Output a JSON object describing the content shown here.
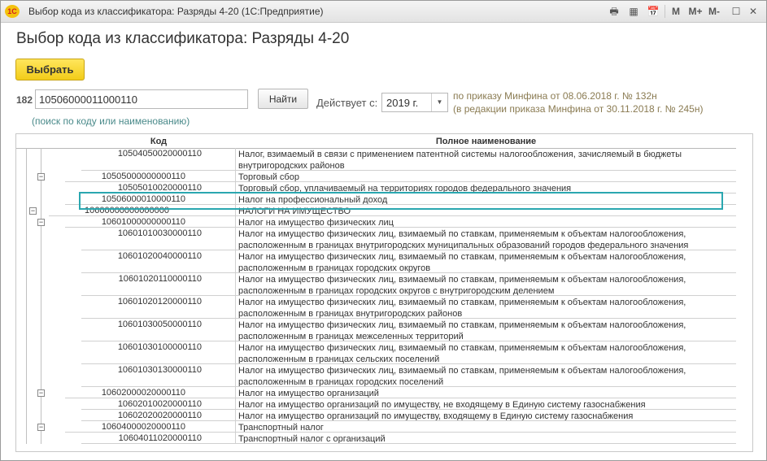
{
  "window": {
    "title": "Выбор кода из классификатора: Разряды 4-20",
    "app": "(1С:Предприятие)",
    "logo_text": "1С",
    "toolbar": [
      "M",
      "M+",
      "M-"
    ]
  },
  "form": {
    "heading": "Выбор кода из классификатора: Разряды 4-20",
    "select_button": "Выбрать",
    "code_prefix": "182",
    "code_value": "10506000011000110",
    "hint": "(поиск по коду или наименованию)",
    "find_button": "Найти",
    "valid_from_label": "Действует с:",
    "year_value": "2019 г.",
    "order_line1": "по приказу Минфина от 08.06.2018 г. № 132н",
    "order_line2": "(в редакции приказа Минфина от 30.11.2018 г. № 245н)",
    "accent_color": "#f2cc19",
    "highlight_color": "#2aa7b0"
  },
  "table": {
    "columns": [
      "Код",
      "Полное наименование"
    ],
    "rows": [
      {
        "code": "10504050020000110",
        "name": "Налог, взимаемый в связи с применением патентной системы налогообложения, зачисляемый в бюджеты внутригородских районов",
        "level": 4,
        "group": false
      },
      {
        "code": "10505000000000110",
        "name": "Торговый сбор",
        "level": 3,
        "group": true
      },
      {
        "code": "10505010020000110",
        "name": "Торговый сбор, уплачиваемый на территориях городов федерального значения",
        "level": 4,
        "group": false
      },
      {
        "code": "10506000010000110",
        "name": "Налог на профессиональный доход",
        "level": 3,
        "group": false
      },
      {
        "code": "10600000000000000",
        "name": "НАЛОГИ НА ИМУЩЕСТВО",
        "level": 2,
        "group": true
      },
      {
        "code": "10601000000000110",
        "name": "Налог на имущество физических лиц",
        "level": 3,
        "group": true
      },
      {
        "code": "10601010030000110",
        "name": "Налог на имущество физических лиц, взимаемый по ставкам, применяемым к объектам налогообложения, расположенным в границах внутригородских муниципальных образований городов федерального значения",
        "level": 4,
        "group": false
      },
      {
        "code": "10601020040000110",
        "name": "Налог на имущество физических лиц, взимаемый по ставкам, применяемым к объектам налогообложения, расположенным в границах городских округов",
        "level": 4,
        "group": false
      },
      {
        "code": "10601020110000110",
        "name": "Налог на имущество физических лиц, взимаемый по ставкам, применяемым к объектам налогообложения, расположенным в границах городских округов с внутригородским делением",
        "level": 4,
        "group": false
      },
      {
        "code": "10601020120000110",
        "name": "Налог на имущество физических лиц, взимаемый по ставкам, применяемым к объектам налогообложения, расположенным в границах внутригородских районов",
        "level": 4,
        "group": false
      },
      {
        "code": "10601030050000110",
        "name": "Налог на имущество физических лиц, взимаемый по ставкам, применяемым к объектам налогообложения, расположенным в границах межселенных территорий",
        "level": 4,
        "group": false
      },
      {
        "code": "10601030100000110",
        "name": "Налог на имущество физических лиц, взимаемый по ставкам, применяемым к объектам налогообложения, расположенным в границах сельских поселений",
        "level": 4,
        "group": false
      },
      {
        "code": "10601030130000110",
        "name": "Налог на имущество физических лиц, взимаемый по ставкам, применяемым к объектам налогообложения, расположенным в границах городских поселений",
        "level": 4,
        "group": false
      },
      {
        "code": "10602000020000110",
        "name": "Налог на имущество организаций",
        "level": 3,
        "group": true
      },
      {
        "code": "10602010020000110",
        "name": "Налог на имущество организаций по имуществу, не входящему в Единую систему газоснабжения",
        "level": 4,
        "group": false
      },
      {
        "code": "10602020020000110",
        "name": "Налог на имущество организаций по имуществу, входящему в Единую систему газоснабжения",
        "level": 4,
        "group": false
      },
      {
        "code": "10604000020000110",
        "name": "Транспортный налог",
        "level": 3,
        "group": true
      },
      {
        "code": "10604011020000110",
        "name": "Транспортный налог с организаций",
        "level": 4,
        "group": false
      }
    ]
  }
}
